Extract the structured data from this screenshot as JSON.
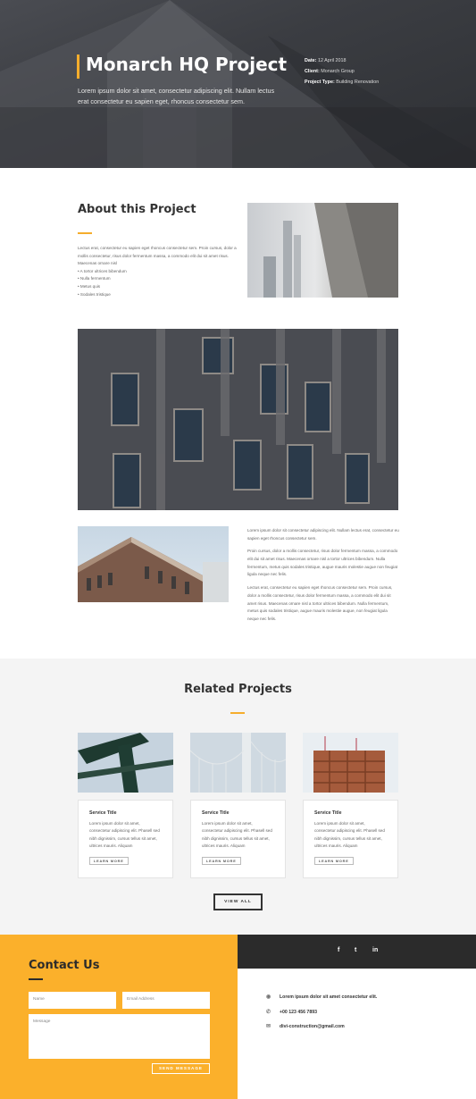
{
  "hero": {
    "title": "Monarch HQ Project",
    "lead": "Lorem ipsum dolor sit amet, consectetur adipiscing elit. Nullam lectus erat consectetur eu sapien eget, rhoncus consectetur sem.",
    "meta": [
      {
        "label": "Date:",
        "value": "12 April 2018"
      },
      {
        "label": "Client:",
        "value": "Monarch Group"
      },
      {
        "label": "Project Type:",
        "value": "Building Renovation"
      }
    ]
  },
  "about": {
    "title": "About this Project",
    "body": "Lectus erat, consectetur eu sapien eget rhoncus consectetur sem. Proin cursus, dolor a mollis consectetur, risus dolor fermentum massa, a commodo elit dui sit amet risus.",
    "subhead": "Maecenas ornare nisl",
    "bullets": [
      "A tortor ultrices bibendum",
      "Nulla fermentum",
      "Metus quis",
      "Sodales tristique"
    ]
  },
  "details": {
    "p1": "Lorem ipsum dolor sit consectetur adipiscing elit. Nullam lectus erat, consectetur eu sapien eget rhoncus consectetur sem.",
    "p2": "Proin cursus, dolor a mollis consectetur, risus dolor fermentum massa, a commodo elit dui sit amet risus. Maecenas ornare nisl a tortor ultrices bibendum. Nulla fermentum, metus quis sodales tristique, augue mauris molestie augue non feugiat ligula neque nec felis.",
    "p3": "Lectus erat, consectetur eu sapien eget rhoncus consectetur sem. Proin cursus, dolor a mollis consectetur, risus dolor fermentum massa, a commodo elit dui sit amet risus. Maecenas ornare nisl a tortor ultrices bibendum. Nulla fermentum, metus quis sodales tristique, augue mauris molestie augue, non feugiat ligula neque nec felis."
  },
  "related": {
    "title": "Related Projects",
    "cards": [
      {
        "title": "Service Title",
        "desc": "Lorem ipsum dolor sit amet, consectetur adipiscing elit. Phasell sed nibh dignissim, cursus tellus sit amet, ultrices mauris. Aliquam",
        "link": "LEARN MORE"
      },
      {
        "title": "Service Title",
        "desc": "Lorem ipsum dolor sit amet, consectetur adipiscing elit. Phasell sed nibh dignissim, cursus tellus sit amet, ultrices mauris. Aliquam",
        "link": "LEARN MORE"
      },
      {
        "title": "Service Title",
        "desc": "Lorem ipsum dolor sit amet, consectetur adipiscing elit. Phasell sed nibh dignissim, cursus tellus sit amet, ultrices mauris. Aliquam",
        "link": "LEARN MORE"
      }
    ],
    "view_all": "VIEW ALL"
  },
  "contact": {
    "title": "Contact Us",
    "name_placeholder": "Name",
    "email_placeholder": "Email Address",
    "message_placeholder": "Message",
    "send": "SEND MESSAGE"
  },
  "social": {
    "facebook": "f",
    "twitter": "t",
    "linkedin": "in"
  },
  "info": {
    "address": "Lorem ipsum dolor sit amet consectetur elit.",
    "phone": "+00 123 456 7893",
    "email": "divi-construction@gmail.com"
  },
  "colors": {
    "accent": "#f5ad2c",
    "contact_bg": "#fbb02b",
    "dark": "#2b2b2b"
  },
  "icons": [
    "map-pin-icon",
    "phone-icon",
    "envelope-icon",
    "facebook-icon",
    "twitter-icon",
    "linkedin-icon"
  ]
}
